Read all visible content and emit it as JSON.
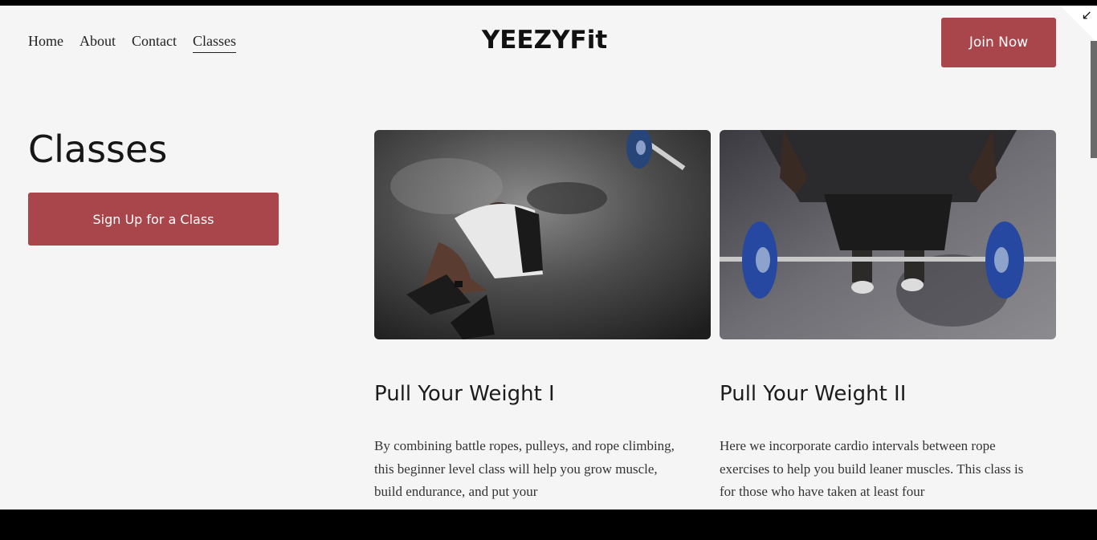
{
  "nav": {
    "items": [
      {
        "label": "Home"
      },
      {
        "label": "About"
      },
      {
        "label": "Contact"
      },
      {
        "label": "Classes",
        "active": true
      }
    ]
  },
  "brand": {
    "name": "YEEZYFit"
  },
  "header": {
    "join_label": "Join Now"
  },
  "page": {
    "title": "Classes",
    "signup_label": "Sign Up for a Class"
  },
  "classes": [
    {
      "title": "Pull Your Weight I",
      "description": "By combining battle ropes, pulleys, and rope climbing, this beginner level class will help you grow muscle, build endurance, and put your",
      "image": "athlete-resting-on-gym-floor-photo"
    },
    {
      "title": "Pull Your Weight II",
      "description": "Here we incorporate cardio intervals between rope exercises to help you build leaner muscles. This class is for those who have taken at least four",
      "image": "athlete-standing-over-barbell-photo"
    }
  ],
  "colors": {
    "accent": "#a8464b",
    "background": "#f5f5f5"
  },
  "icons": {
    "corner": "collapse-arrow-icon"
  }
}
